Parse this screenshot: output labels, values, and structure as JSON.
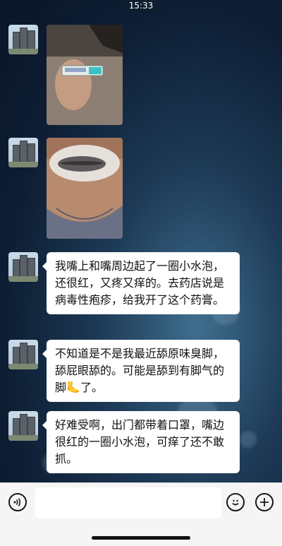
{
  "status_bar": {
    "time": "15:33"
  },
  "messages": [
    {
      "type": "image",
      "description": "tube of ointment held in hand"
    },
    {
      "type": "image",
      "description": "lips covered with white ointment"
    },
    {
      "type": "text",
      "text": "我嘴上和嘴周边起了一圈小水泡，还很红，又疼又痒的。去药店说是病毒性疱疹，给我开了这个药膏。"
    },
    {
      "type": "text",
      "text": "不知道是不是我最近舔原味臭脚，舔屁眼舔的。可能是舔到有脚气的脚",
      "emoji": "🦶",
      "text_after": "了。"
    },
    {
      "type": "text",
      "text": "好难受啊，出门都带着口罩，嘴边很红的一圈小水泡，可痒了还不敢抓。"
    }
  ],
  "input_bar": {
    "voice_icon": "voice-icon",
    "emoji_icon": "emoji-icon",
    "plus_icon": "plus-icon",
    "input_value": ""
  }
}
